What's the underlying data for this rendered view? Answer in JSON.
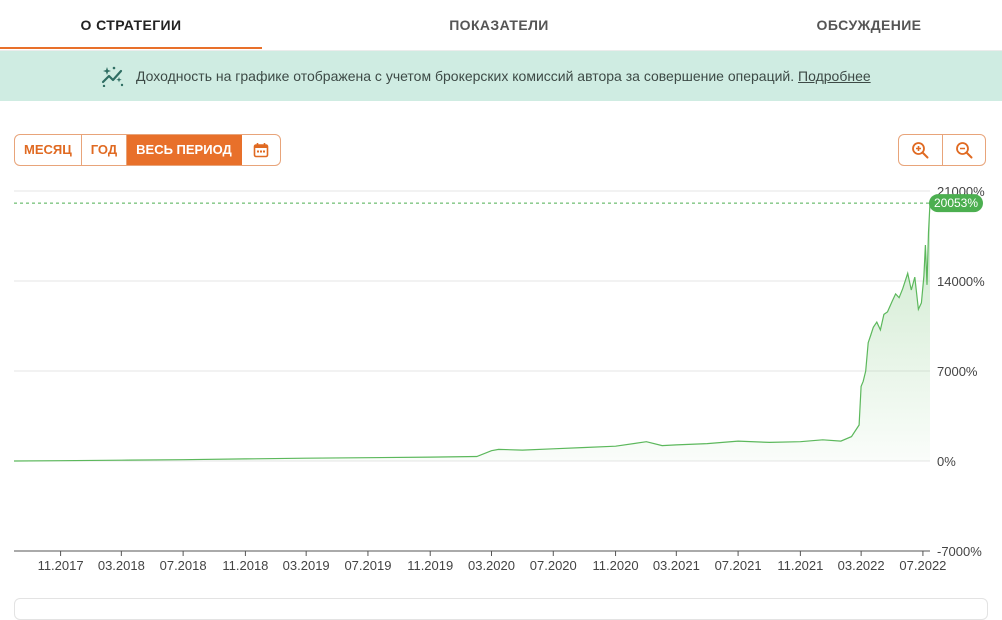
{
  "tabs": [
    {
      "label": "О СТРАТЕГИИ",
      "active": true
    },
    {
      "label": "ПОКАЗАТЕЛИ",
      "active": false
    },
    {
      "label": "ОБСУЖДЕНИЕ",
      "active": false
    }
  ],
  "banner": {
    "icon": "sparkle-chart-icon",
    "text": "Доходность на графике отображена с учетом брокерских комиссий автора за совершение операций.",
    "link": "Подробнее"
  },
  "period": {
    "buttons": [
      "МЕСЯЦ",
      "ГОД",
      "ВЕСЬ ПЕРИОД"
    ],
    "active": "ВЕСЬ ПЕРИОД",
    "calendar_icon": "calendar-icon"
  },
  "zoom": {
    "in_icon": "zoom-in-icon",
    "out_icon": "zoom-out-icon"
  },
  "colors": {
    "accent": "#e8702a",
    "line": "#5cb85c",
    "badge": "#4caf50",
    "banner": "#cfece2"
  },
  "chart_data": {
    "type": "area",
    "y_ticks": [
      "21000%",
      "14000%",
      "7000%",
      "0%",
      "-7000%"
    ],
    "ylim": [
      -7000,
      21000
    ],
    "x_ticks": [
      "11.2017",
      "03.2018",
      "07.2018",
      "11.2018",
      "03.2019",
      "07.2019",
      "11.2019",
      "03.2020",
      "07.2020",
      "11.2020",
      "03.2021",
      "07.2021",
      "11.2021",
      "03.2022",
      "07.2022"
    ],
    "x_ticks_pos": [
      "2017-11-01",
      "2018-03-01",
      "2018-07-01",
      "2018-11-01",
      "2019-03-01",
      "2019-07-01",
      "2019-11-01",
      "2020-03-01",
      "2020-07-01",
      "2020-11-01",
      "2021-03-01",
      "2021-07-01",
      "2021-11-01",
      "2022-03-01",
      "2022-07-01"
    ],
    "current_value_label": "20053%",
    "current_value": 20053,
    "grid": true,
    "series": [
      {
        "x": [
          "2017-08-01",
          "2017-11-01",
          "2018-03-01",
          "2018-07-01",
          "2018-11-01",
          "2019-03-01",
          "2019-07-01",
          "2019-11-01",
          "2020-02-01",
          "2020-03-01",
          "2020-03-15",
          "2020-05-01",
          "2020-07-01",
          "2020-09-01",
          "2020-11-01",
          "2021-01-01",
          "2021-02-01",
          "2021-03-01",
          "2021-05-01",
          "2021-07-01",
          "2021-09-01",
          "2021-11-01",
          "2021-12-15",
          "2022-01-20",
          "2022-02-10",
          "2022-02-25",
          "2022-03-01",
          "2022-03-05",
          "2022-03-10",
          "2022-03-15",
          "2022-03-20",
          "2022-03-25",
          "2022-04-01",
          "2022-04-08",
          "2022-04-15",
          "2022-04-22",
          "2022-05-01",
          "2022-05-08",
          "2022-05-15",
          "2022-05-22",
          "2022-06-01",
          "2022-06-08",
          "2022-06-15",
          "2022-06-22",
          "2022-06-28",
          "2022-07-03",
          "2022-07-06",
          "2022-07-09",
          "2022-07-12",
          "2022-07-15"
        ],
        "y": [
          0,
          20,
          60,
          100,
          160,
          220,
          260,
          300,
          350,
          800,
          900,
          850,
          950,
          1050,
          1150,
          1500,
          1200,
          1250,
          1350,
          1550,
          1450,
          1500,
          1650,
          1550,
          1900,
          2800,
          5800,
          6200,
          7000,
          9200,
          9800,
          10400,
          10800,
          10200,
          11400,
          11600,
          12400,
          13000,
          12700,
          13400,
          14600,
          13300,
          14300,
          11800,
          12300,
          14400,
          16800,
          13700,
          17800,
          20053
        ]
      }
    ]
  }
}
